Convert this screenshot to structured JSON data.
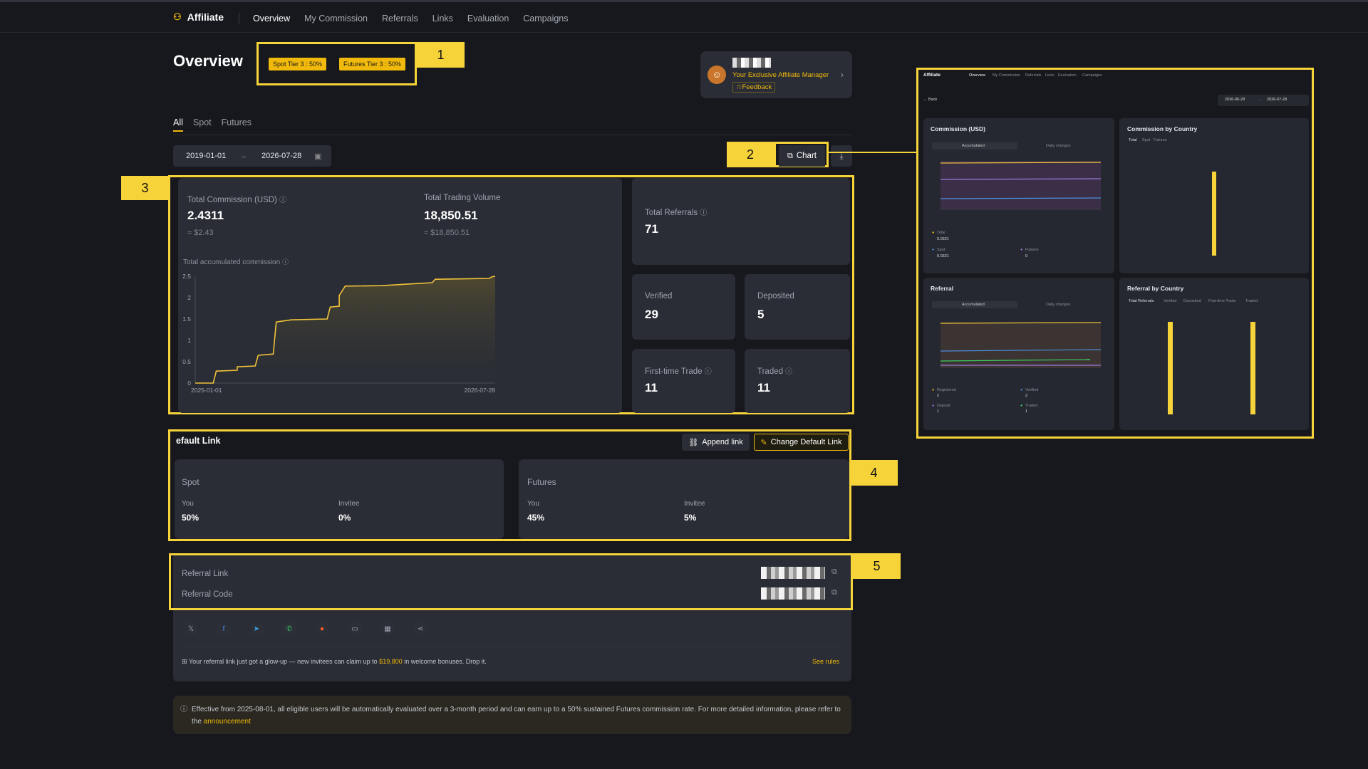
{
  "nav": {
    "brand": "Affiliate",
    "items": [
      "Overview",
      "My Commission",
      "Referrals",
      "Links",
      "Evaluation",
      "Campaigns"
    ]
  },
  "page_title": "Overview",
  "tiers": {
    "spot": "Spot Tier 3 : 50%",
    "futures": "Futures Tier 3 : 50%"
  },
  "callouts": [
    "1",
    "2",
    "3",
    "4",
    "5"
  ],
  "manager": {
    "label": "Your Exclusive Affiliate Manager",
    "feedback": "☆Feedback"
  },
  "tabs": [
    "All",
    "Spot",
    "Futures"
  ],
  "date_range": {
    "start": "2019-01-01",
    "end": "2026-07-28"
  },
  "chart_button": "Chart",
  "commission": {
    "total_label": "Total Commission (USD)",
    "total_value": "2.4311",
    "total_usd": "≈ $2.43",
    "volume_label": "Total Trading Volume",
    "volume_value": "18,850.51",
    "volume_usd": "≈ $18,850.51"
  },
  "chart_data": {
    "type": "line",
    "title": "Total accumulated commission",
    "x_start": "2025-01-01",
    "x_end": "2026-07-28",
    "ylim": [
      0,
      2.5
    ],
    "yticks": [
      "0",
      "0.5",
      "1",
      "1.5",
      "2",
      "2.5"
    ],
    "points": [
      [
        0,
        0.0
      ],
      [
        0.06,
        0.0
      ],
      [
        0.07,
        0.28
      ],
      [
        0.14,
        0.3
      ],
      [
        0.14,
        0.38
      ],
      [
        0.2,
        0.4
      ],
      [
        0.21,
        0.65
      ],
      [
        0.26,
        0.68
      ],
      [
        0.27,
        1.43
      ],
      [
        0.32,
        1.48
      ],
      [
        0.44,
        1.5
      ],
      [
        0.45,
        1.78
      ],
      [
        0.48,
        1.8
      ],
      [
        0.48,
        2.05
      ],
      [
        0.5,
        2.27
      ],
      [
        0.62,
        2.28
      ],
      [
        0.74,
        2.33
      ],
      [
        0.79,
        2.35
      ],
      [
        0.8,
        2.43
      ],
      [
        0.9,
        2.44
      ],
      [
        0.98,
        2.45
      ],
      [
        0.99,
        2.49
      ],
      [
        1.0,
        2.5
      ]
    ]
  },
  "stats": {
    "referrals_label": "Total Referrals",
    "referrals_value": "71",
    "verified_label": "Verified",
    "verified_value": "29",
    "deposited_label": "Deposited",
    "deposited_value": "5",
    "first_trade_label": "First-time Trade",
    "first_trade_value": "11",
    "traded_label": "Traded",
    "traded_value": "11"
  },
  "default_link": {
    "title": "efault Link",
    "append": "Append link",
    "change": "Change Default Link",
    "spot": {
      "title": "Spot",
      "you_label": "You",
      "you": "50%",
      "invitee_label": "Invitee",
      "invitee": "0%"
    },
    "futures": {
      "title": "Futures",
      "you_label": "You",
      "you": "45%",
      "invitee_label": "Invitee",
      "invitee": "5%"
    }
  },
  "referral": {
    "link_label": "Referral Link",
    "code_label": "Referral Code"
  },
  "share_icons": [
    "x-icon",
    "facebook-icon",
    "telegram-icon",
    "whatsapp-icon",
    "reddit-icon",
    "message-icon",
    "qr-icon",
    "share-icon"
  ],
  "promo": {
    "pre": "Your referral link just got a glow-up — new invitees can claim up to ",
    "amount": "$19,800",
    "post": " in welcome bonuses. Drop it.",
    "rules": "See rules"
  },
  "notice": {
    "text": "Effective from 2025-08-01, all eligible users will be automatically evaluated over a 3-month period and can earn up to a 50% sustained Futures commission rate. For more detailed information, please refer to the ",
    "link": "announcement"
  },
  "preview": {
    "brand": "Affiliate",
    "nav": [
      "Overview",
      "My Commission",
      "Referrals",
      "Links",
      "Evaluation",
      "Campaigns"
    ],
    "back": "← Back",
    "date_start": "2026-06-28",
    "date_end": "2026-07-28",
    "commission_title": "Commission (USD)",
    "toggle": [
      "Accumulated",
      "Daily changes"
    ],
    "country_title": "Commission by Country",
    "country_tabs": [
      "Total",
      "Spot",
      "Futures"
    ],
    "referral_title": "Referral",
    "referral_country_title": "Referral by Country",
    "referral_country_tabs": [
      "Total Referrals",
      "Verified",
      "Deposited",
      "First-time Trade",
      "Traded"
    ],
    "commission_legend": [
      "Total",
      "Spot",
      "Futures"
    ],
    "commission_values": [
      "0.0321",
      "0.0321",
      "0"
    ],
    "referral_legend": [
      "Registered",
      "Verified",
      "Deposit",
      "Traded"
    ],
    "referral_values": [
      "2",
      "2",
      "1",
      "1"
    ]
  },
  "colors": {
    "accent": "#f0b90b",
    "highlight": "#f7d33a",
    "bg": "#16181d",
    "card": "#2a2d35"
  }
}
